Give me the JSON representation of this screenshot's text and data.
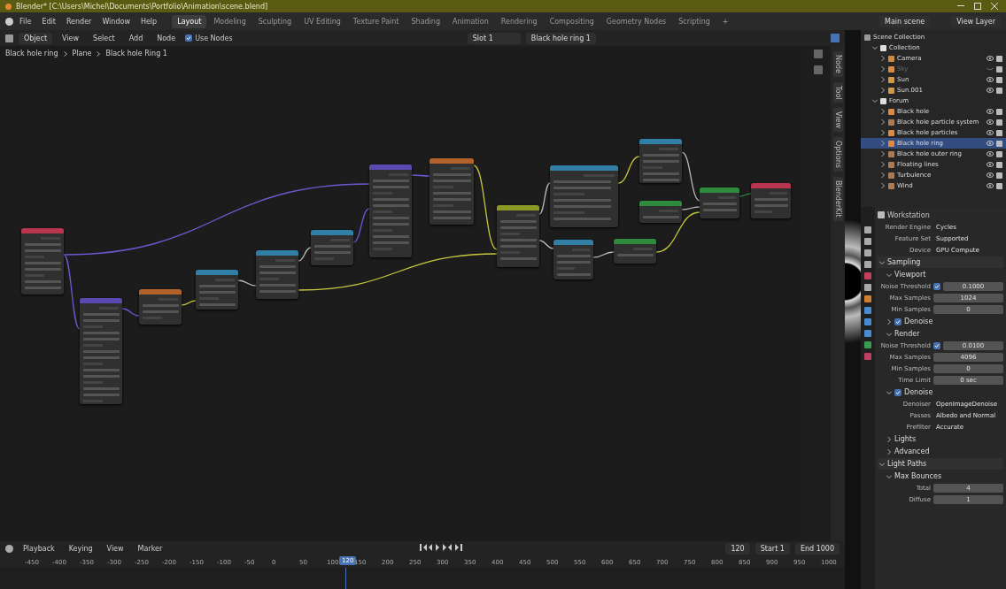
{
  "window": {
    "title": "Blender* [C:\\Users\\Michel\\Documents\\Portfolio\\Animation\\scene.blend]"
  },
  "menu": [
    "File",
    "Edit",
    "Render",
    "Window",
    "Help"
  ],
  "workspaces": [
    {
      "label": "Layout",
      "selected": true
    },
    {
      "label": "Modeling",
      "selected": false
    },
    {
      "label": "Sculpting",
      "selected": false
    },
    {
      "label": "UV Editing",
      "selected": false
    },
    {
      "label": "Texture Paint",
      "selected": false
    },
    {
      "label": "Shading",
      "selected": false
    },
    {
      "label": "Animation",
      "selected": false
    },
    {
      "label": "Rendering",
      "selected": false
    },
    {
      "label": "Compositing",
      "selected": false
    },
    {
      "label": "Geometry Nodes",
      "selected": false
    },
    {
      "label": "Scripting",
      "selected": false
    }
  ],
  "workspace_add": "+",
  "scene": "Main scene",
  "view_layer": "View Layer",
  "editor_header": {
    "mode": "Object",
    "menus": [
      "View",
      "Select",
      "Add",
      "Node"
    ],
    "use_nodes": {
      "label": "Use Nodes",
      "checked": true
    },
    "slot": "Slot 1",
    "material": "Black hole ring 1"
  },
  "breadcrumb": [
    "Black hole ring",
    "Plane",
    "Black hole Ring 1"
  ],
  "nodes": [
    {
      "color": "#b8344f"
    },
    {
      "color": "#5a4ab0"
    },
    {
      "color": "#b3602a"
    },
    {
      "color": "#2f7fa6"
    },
    {
      "color": "#2f7fa6"
    },
    {
      "color": "#2f7fa6"
    },
    {
      "color": "#5a4ab0"
    },
    {
      "color": "#b3602a"
    },
    {
      "color": "#8a9a22"
    },
    {
      "color": "#2f7fa6"
    },
    {
      "color": "#2f7fa6"
    },
    {
      "color": "#2e8a3c"
    },
    {
      "color": "#2f7fa6"
    },
    {
      "color": "#2e8a3c"
    },
    {
      "color": "#2e8a3c"
    },
    {
      "color": "#b8344f"
    }
  ],
  "sidebar_tabs": [
    "Node",
    "Tool",
    "View",
    "Options",
    "BlenderKit"
  ],
  "outliner": {
    "root": "Scene Collection",
    "collections": [
      {
        "label": "Collection",
        "expanded": true,
        "children": [
          {
            "label": "Camera",
            "kind": "camera",
            "selected": false,
            "visible": true
          },
          {
            "label": "Sky",
            "kind": "mesh",
            "selected": false,
            "visible": false
          },
          {
            "label": "Sun",
            "kind": "light",
            "selected": false,
            "visible": true
          },
          {
            "label": "Sun.001",
            "kind": "light",
            "selected": false,
            "visible": true
          }
        ]
      },
      {
        "label": "Forum",
        "expanded": true,
        "children": [
          {
            "label": "Black hole",
            "kind": "mesh",
            "selected": false,
            "visible": true
          },
          {
            "label": "Black hole particle system",
            "kind": "empty",
            "selected": false,
            "visible": true
          },
          {
            "label": "Black hole particles",
            "kind": "mesh",
            "selected": false,
            "visible": true
          },
          {
            "label": "Black hole ring",
            "kind": "mesh",
            "selected": true,
            "visible": true
          },
          {
            "label": "Black hole outer ring",
            "kind": "empty",
            "selected": false,
            "visible": true
          },
          {
            "label": "Floating lines",
            "kind": "empty",
            "selected": false,
            "visible": true
          },
          {
            "label": "Turbulence",
            "kind": "empty",
            "selected": false,
            "visible": true
          },
          {
            "label": "Wind",
            "kind": "empty",
            "selected": false,
            "visible": true
          }
        ]
      }
    ]
  },
  "properties": {
    "title": "Workstation",
    "rows": [
      {
        "kind": "dropdown",
        "label": "Render Engine",
        "value": "Cycles"
      },
      {
        "kind": "dropdown",
        "label": "Feature Set",
        "value": "Supported"
      },
      {
        "kind": "dropdown",
        "label": "Device",
        "value": "GPU Compute"
      },
      {
        "kind": "panel",
        "label": "Sampling",
        "expanded": true
      },
      {
        "kind": "subpanel",
        "label": "Viewport",
        "expanded": true
      },
      {
        "kind": "checkfield",
        "label": "Noise Threshold",
        "checked": true,
        "value": "0.1000"
      },
      {
        "kind": "field",
        "label": "Max Samples",
        "value": "1024"
      },
      {
        "kind": "field",
        "label": "Min Samples",
        "value": "0"
      },
      {
        "kind": "checkheader",
        "label": "Denoise",
        "checked": true,
        "expanded": false
      },
      {
        "kind": "subpanel",
        "label": "Render",
        "expanded": true
      },
      {
        "kind": "checkfield",
        "label": "Noise Threshold",
        "checked": true,
        "value": "0.0100"
      },
      {
        "kind": "field",
        "label": "Max Samples",
        "value": "4096"
      },
      {
        "kind": "field",
        "label": "Min Samples",
        "value": "0"
      },
      {
        "kind": "field",
        "label": "Time Limit",
        "value": "0 sec"
      },
      {
        "kind": "checkheader",
        "label": "Denoise",
        "checked": true,
        "expanded": true
      },
      {
        "kind": "dropdown",
        "label": "Denoiser",
        "value": "OpenImageDenoise"
      },
      {
        "kind": "dropdown",
        "label": "Passes",
        "value": "Albedo and Normal"
      },
      {
        "kind": "dropdown",
        "label": "Prefilter",
        "value": "Accurate"
      },
      {
        "kind": "subpanel",
        "label": "Lights",
        "expanded": false
      },
      {
        "kind": "subpanel",
        "label": "Advanced",
        "expanded": false
      },
      {
        "kind": "panel",
        "label": "Light Paths",
        "expanded": true
      },
      {
        "kind": "subpanel",
        "label": "Max Bounces",
        "expanded": true
      },
      {
        "kind": "field",
        "label": "Total",
        "value": "4"
      },
      {
        "kind": "field",
        "label": "Diffuse",
        "value": "1"
      }
    ]
  },
  "timeline": {
    "menus": [
      "Playback",
      "Keying",
      "View",
      "Marker"
    ],
    "ticks": [
      "-450",
      "-400",
      "-350",
      "-300",
      "-250",
      "-200",
      "-150",
      "-100",
      "-50",
      "0",
      "50",
      "100",
      "150",
      "200",
      "250",
      "300",
      "350",
      "400",
      "450",
      "500",
      "550",
      "600",
      "650",
      "700",
      "750",
      "800",
      "850",
      "900",
      "950",
      "1000"
    ],
    "current_frame": "120",
    "frame_field": "120",
    "start_label": "Start",
    "start": "1",
    "end_label": "End",
    "end": "1000"
  }
}
